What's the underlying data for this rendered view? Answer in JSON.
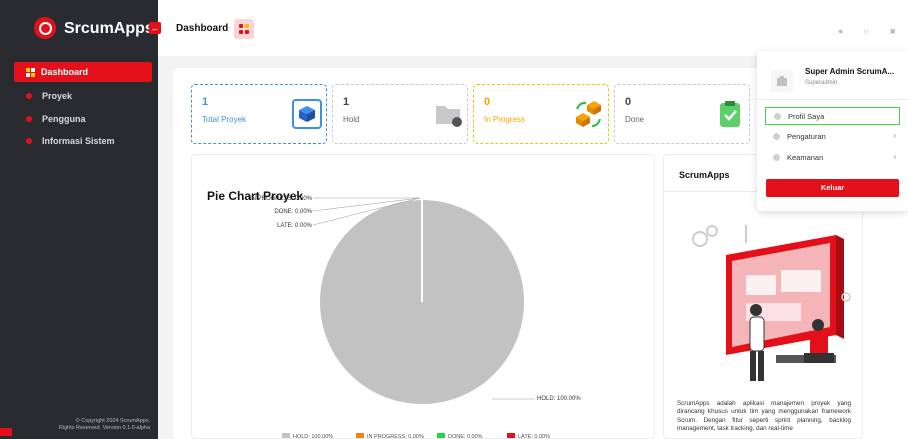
{
  "app": {
    "name": "SrcumApps"
  },
  "sidebar": {
    "items": [
      {
        "label": "Dashboard"
      },
      {
        "label": "Proyek"
      },
      {
        "label": "Pengguna"
      },
      {
        "label": "Informasi Sistem"
      }
    ],
    "footer_line1": "© Copyright 2024 ScrumApps.",
    "footer_line2": "Rights Reserved. Version 0.1.0-alpha"
  },
  "topbar": {
    "title": "Dashboard"
  },
  "stats": [
    {
      "value": "1",
      "label": "Total Proyek",
      "color": "#3f8ee8"
    },
    {
      "value": "1",
      "label": "Hold",
      "color": "#8a8a8a"
    },
    {
      "value": "0",
      "label": "In Progress",
      "color": "#f5a400"
    },
    {
      "value": "0",
      "label": "Done",
      "color": "#2bb94a"
    }
  ],
  "chart_data": {
    "type": "pie",
    "title": "Pie Chart Proyek",
    "categories": [
      "HOLD",
      "IN PROGRESS",
      "DONE",
      "LATE"
    ],
    "values": [
      100,
      0,
      0,
      0
    ],
    "labels": [
      "HOLD: 100.00%",
      "IN PROGRESS: 0.00%",
      "DONE: 0.00%",
      "LATE: 0.00%"
    ],
    "legend": [
      "HOLD: 100.00%",
      "IN PROGRESS: 0.00%",
      "DONE: 0.00%",
      "LATE: 0.00%"
    ],
    "colors": [
      "#c2c2c2",
      "#f5820a",
      "#22d44a",
      "#e3101a"
    ],
    "legend_position": "bottom"
  },
  "side_panel": {
    "title": "ScrumApps",
    "description": "ScrumApps adalah aplikasi manajemen proyek yang dirancang khusus untuk tim yang menggunakan framework Scrum. Dengan fitur seperti sprint planning, backlog management, task tracking, dan real-time"
  },
  "profile_menu": {
    "name": "Super Admin ScrumA...",
    "role": "Superadmin",
    "items": [
      {
        "label": "Profil Saya"
      },
      {
        "label": "Pengaturan"
      },
      {
        "label": "Keamanan"
      }
    ],
    "logout_label": "Keluar"
  }
}
